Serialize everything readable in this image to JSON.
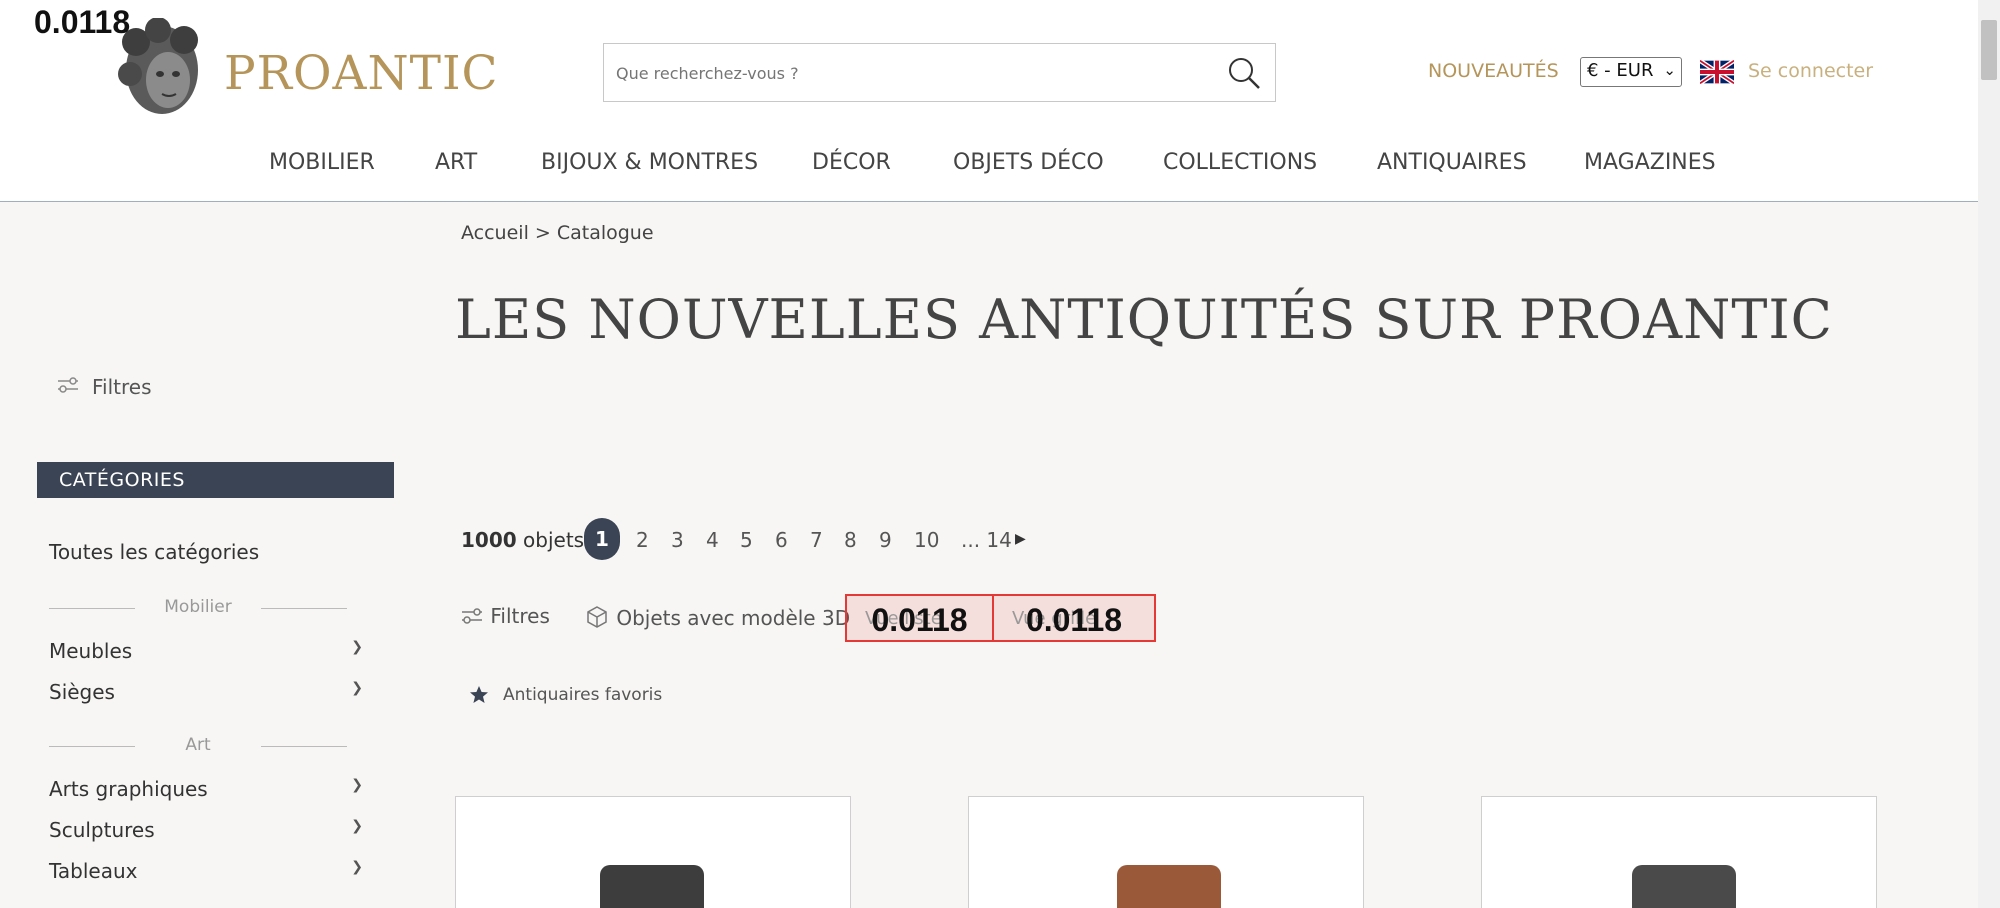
{
  "overlay": {
    "badge_value": "0.0118"
  },
  "header": {
    "logo_text": "PROANTIC",
    "search_placeholder": "Que recherchez-vous ?",
    "nouveautes": "NOUVEAUTÉS",
    "currency": "€ - EUR",
    "login": "Se connecter"
  },
  "nav": {
    "items": [
      "MOBILIER",
      "ART",
      "BIJOUX & MONTRES",
      "DÉCOR",
      "OBJETS DÉCO",
      "COLLECTIONS",
      "ANTIQUAIRES",
      "MAGAZINES"
    ]
  },
  "breadcrumb": "Accueil > Catalogue",
  "page_title": "LES NOUVELLES ANTIQUITÉS SUR PROANTIC",
  "sidebar": {
    "filter_label": "Filtres",
    "categories_header": "CATÉGORIES",
    "all_categories": "Toutes les catégories",
    "groups": [
      {
        "label": "Mobilier",
        "items": [
          "Meubles",
          "Sièges"
        ]
      },
      {
        "label": "Art",
        "items": [
          "Arts graphiques",
          "Sculptures",
          "Tableaux"
        ]
      }
    ]
  },
  "results": {
    "count_number": "1000",
    "count_label": "objets",
    "pages": [
      "1",
      "2",
      "3",
      "4",
      "5",
      "6",
      "7",
      "8",
      "9",
      "10",
      "... 14"
    ],
    "next_icon": "caret-right-icon"
  },
  "toolbar": {
    "filter_label": "Filtres",
    "model3d_label": "Objets avec modèle 3D",
    "view_list_value": "0.0118",
    "view_list_ghost": "Vue liste",
    "view_grid_value": "0.0118",
    "view_grid_ghost": "Vue grille"
  },
  "favorites": {
    "label": "Antiquaires favoris"
  },
  "colors": {
    "gold": "#b5955a",
    "dark_slate": "#3b4454",
    "highlight_red": "#e53935",
    "background": "#f7f6f4"
  }
}
